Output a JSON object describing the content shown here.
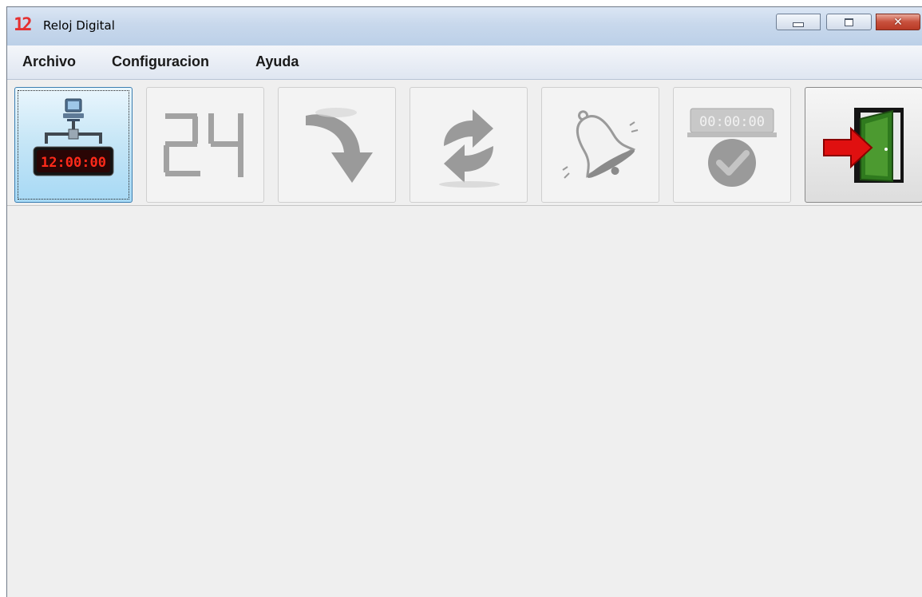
{
  "window": {
    "title": "Reloj Digital",
    "app_icon_text": "12",
    "close_glyph": "✕"
  },
  "menu": [
    "Archivo",
    "Configuracion",
    "Ayuda"
  ],
  "toolbar": {
    "buttons": [
      {
        "name": "network-clock-button",
        "icon": "network-clock-icon",
        "display_text": "12:00:00",
        "state": "focused"
      },
      {
        "name": "24-hour-button",
        "icon": "24-hour-icon",
        "display_text": "24",
        "state": "disabled"
      },
      {
        "name": "forward-button",
        "icon": "curved-arrow-icon",
        "state": "disabled"
      },
      {
        "name": "sync-button",
        "icon": "refresh-arrows-icon",
        "state": "disabled"
      },
      {
        "name": "alarm-button",
        "icon": "bell-icon",
        "state": "disabled"
      },
      {
        "name": "timer-check-button",
        "icon": "timer-check-icon",
        "display_text": "00:00:00",
        "state": "disabled"
      },
      {
        "name": "exit-button",
        "icon": "exit-door-icon",
        "state": "enabled"
      }
    ]
  },
  "colors": {
    "title_bar": "#c8d8ec",
    "close_button": "#c8503c",
    "active_button": "#c4e5f6",
    "digit_red": "#ff2020",
    "disabled_gray": "#9a9a9a",
    "door_green": "#2f7a1e",
    "arrow_red": "#e01010"
  }
}
